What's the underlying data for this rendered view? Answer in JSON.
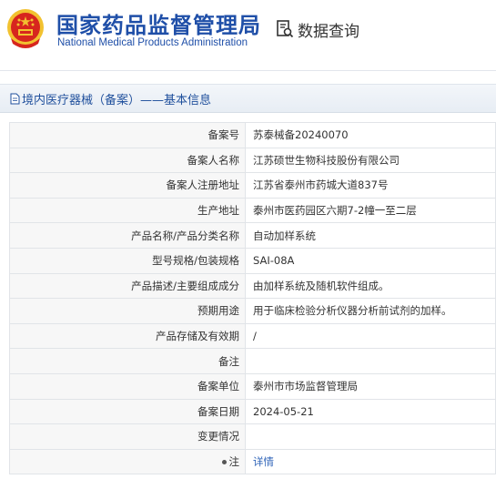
{
  "header": {
    "title_cn": "国家药品监督管理局",
    "title_en": "National Medical Products Administration",
    "query_label": "数据查询",
    "query_icon": "search-document-icon",
    "emblem_icon": "national-emblem-icon"
  },
  "section": {
    "title": "境内医疗器械（备案）——基本信息",
    "icon": "document-icon"
  },
  "rows": [
    {
      "label": "备案号",
      "value": "苏泰械备20240070"
    },
    {
      "label": "备案人名称",
      "value": "江苏硕世生物科技股份有限公司"
    },
    {
      "label": "备案人注册地址",
      "value": "江苏省泰州市药城大道837号"
    },
    {
      "label": "生产地址",
      "value": "泰州市医药园区六期7-2幢一至二层"
    },
    {
      "label": "产品名称/产品分类名称",
      "value": "自动加样系统"
    },
    {
      "label": "型号规格/包装规格",
      "value": "SAI-08A"
    },
    {
      "label": "产品描述/主要组成成分",
      "value": "由加样系统及随机软件组成。"
    },
    {
      "label": "预期用途",
      "value": "用于临床检验分析仪器分析前试剂的加样。"
    },
    {
      "label": "产品存储及有效期",
      "value": "/"
    },
    {
      "label": "备注",
      "value": ""
    },
    {
      "label": "备案单位",
      "value": "泰州市市场监督管理局"
    },
    {
      "label": "备案日期",
      "value": "2024-05-21"
    },
    {
      "label": "变更情况",
      "value": ""
    }
  ],
  "note_row": {
    "label": "注",
    "link": "详情"
  },
  "colors": {
    "brand_blue": "#1f4fa8",
    "link_blue": "#2f64b8",
    "label_bg": "#f7f7f7",
    "emblem_red": "#d7261e",
    "emblem_gold": "#f2c230"
  }
}
